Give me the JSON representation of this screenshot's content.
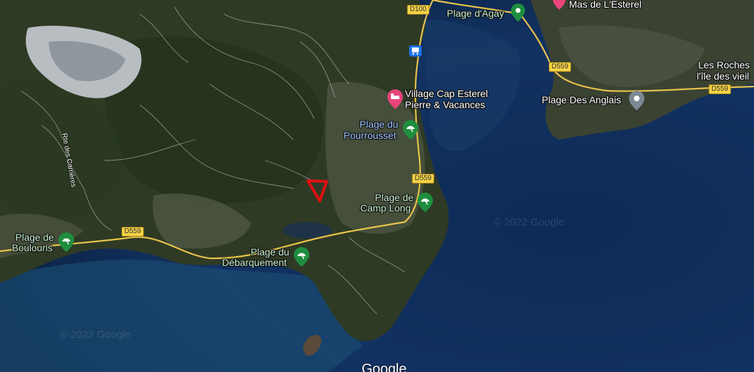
{
  "places": {
    "mas_esterel": "Mas de L'Esterel",
    "plage_agay": "Plage d'Agay",
    "les_roches_1": "Les Roches",
    "les_roches_2": "l'île des vieil",
    "village_cap_1": "Village Cap Esterel",
    "village_cap_2": "Pierre & Vacances",
    "plage_anglais": "Plage Des Anglais",
    "pourrousset_1": "Plage du",
    "pourrousset_2": "Pourrousset",
    "camp_long_1": "Plage de",
    "camp_long_2": "Camp Long",
    "boulouris_1": "Plage de",
    "boulouris_2": "Boulouris",
    "debarquement_1": "Plage du",
    "debarquement_2": "Débarquement",
    "rte_carrieres": "Rte des Carrières"
  },
  "roads": {
    "d100": "D100",
    "d559_a": "D559",
    "d559_b": "D559",
    "d559_c": "D559",
    "d559_d": "D559"
  },
  "watermarks": {
    "w1": "© 2022 Google",
    "w2": "© 2022 Google"
  },
  "attribution": "Google",
  "icons": {
    "beach": "beach-umbrella-icon",
    "hotel": "hotel-bed-icon",
    "bus": "bus-station-icon",
    "place": "place-pin-icon"
  },
  "colors": {
    "sea_deep": "#0f2d52",
    "land": "#2d3a24",
    "road_yellow": "#e8c34a",
    "green_pin": "#1e8e3e",
    "pink_pin": "#e8457a",
    "grey_pin": "#7d8a96",
    "marker_red": "#e01010"
  }
}
